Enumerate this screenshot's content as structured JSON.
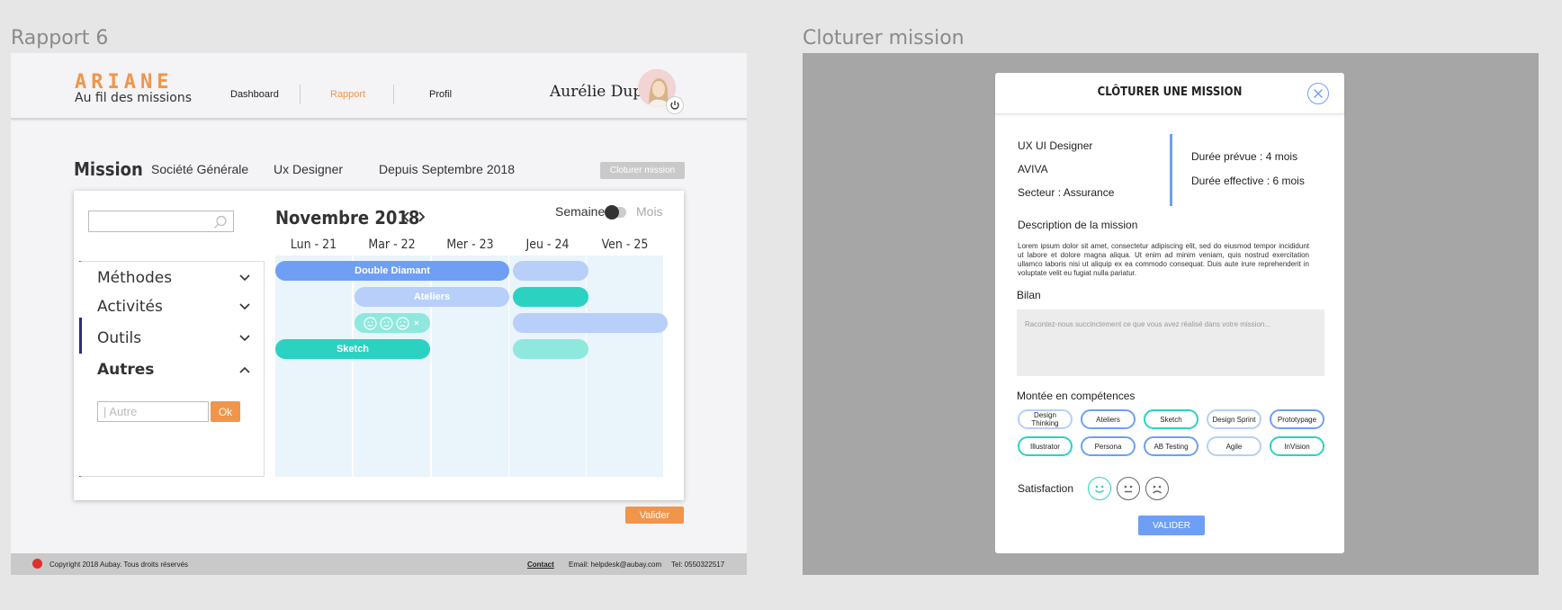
{
  "frames": {
    "left_label": "Rapport 6",
    "right_label": "Cloturer mission"
  },
  "header": {
    "logo_title": "ARIANE",
    "logo_subtitle": "Au fil des missions",
    "nav": [
      "Dashboard",
      "Rapport",
      "Profil"
    ],
    "active_nav": "Rapport",
    "user_name": "Aurélie Dupont"
  },
  "mission": {
    "title": "Mission",
    "company": "Société Générale",
    "role": "Ux Designer",
    "since": "Depuis Septembre 2018",
    "close_button": "Cloturer mission"
  },
  "search": {
    "placeholder": ""
  },
  "accordion": {
    "items": [
      "Méthodes",
      "Activités",
      "Outils",
      "Autres"
    ],
    "expanded": "Autres",
    "autre_placeholder": "| Autre",
    "ok_label": "Ok"
  },
  "calendar": {
    "month": "Novembre 2018",
    "toggle_week": "Semaine",
    "toggle_month": "Mois",
    "days": [
      "Lun - 21",
      "Mar - 22",
      "Mer - 23",
      "Jeu - 24",
      "Ven - 25"
    ],
    "events": {
      "double_diamant": "Double Diamant",
      "ateliers": "Ateliers",
      "sketch": "Sketch"
    }
  },
  "actions": {
    "valider": "Valider"
  },
  "footer": {
    "copyright": "Copyright 2018 Aubay. Tous droits réservés",
    "contact": "Contact",
    "email": "Email: helpdesk@aubay.com",
    "tel": "Tel: 0550322517"
  },
  "modal": {
    "title": "CLÔTURER UNE MISSION",
    "role": "UX UI Designer",
    "client": "AVIVA",
    "sector_label": "Secteur : ",
    "sector": "Assurance",
    "planned_label": "Durée prévue : ",
    "planned": "4 mois",
    "actual_label": "Durée effective : ",
    "actual": "6 mois",
    "description_title": "Description de la mission",
    "description": "Lorem ipsum dolor sit amet, consectetur adipiscing elit, sed do eiusmod tempor incididunt ut labore et dolore magna aliqua. Ut enim ad minim veniam, quis nostrud exercitation ullamco laboris nisi ut aliquip ex ea commodo consequat. Duis aute irure reprehenderit in voluptate velit eu fugiat nulla pariatur.",
    "bilan_title": "Bilan",
    "bilan_placeholder": "Racontez-nous succinctement ce que vous avez réalisé dans votre mission...",
    "skills_title": "Montée en compétences",
    "skills": [
      "Design Thinking",
      "Ateliers",
      "Sketch",
      "Design Sprint",
      "Prototypage",
      "Illustrator",
      "Persona",
      "AB Testing",
      "Agile",
      "InVision"
    ],
    "satisfaction_title": "Satisfaction",
    "valider": "VALIDER"
  },
  "colors": {
    "accent_orange": "#f0954a",
    "blue": "#6e9ff5",
    "light_blue": "#b7cff9",
    "teal": "#2bd2c2",
    "light_teal": "#8ee8de",
    "navy": "#2a2f7a"
  }
}
